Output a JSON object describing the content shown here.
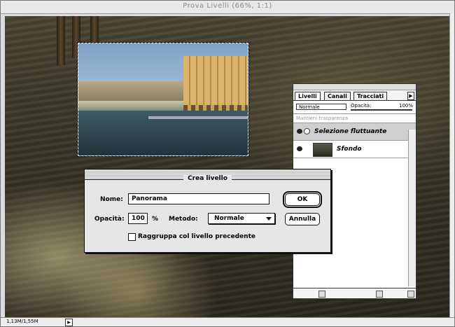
{
  "window": {
    "title": "Prova Livelli (66%, 1:1)"
  },
  "layers_panel": {
    "tabs": [
      "Livelli",
      "Canali",
      "Tracciati"
    ],
    "blend_mode": "Normale",
    "opacity_label": "Opacità:",
    "opacity_value": "100%",
    "preserve_transparency": "Mantieni trasparenza",
    "layers": [
      {
        "name": "Selezione fluttuante",
        "selected": true
      },
      {
        "name": "Sfondo",
        "selected": false
      }
    ]
  },
  "dialog": {
    "title": "Crea livello",
    "name_label": "Nome:",
    "name_value": "Panorama",
    "opacity_label": "Opacità:",
    "opacity_value": "100",
    "percent": "%",
    "method_label": "Metodo:",
    "method_value": "Normale",
    "ok_label": "OK",
    "cancel_label": "Annulla",
    "group_label": "Raggruppa col livello precedente",
    "group_checked": false
  },
  "status": {
    "doc_size": "1,13M/1,55M"
  }
}
